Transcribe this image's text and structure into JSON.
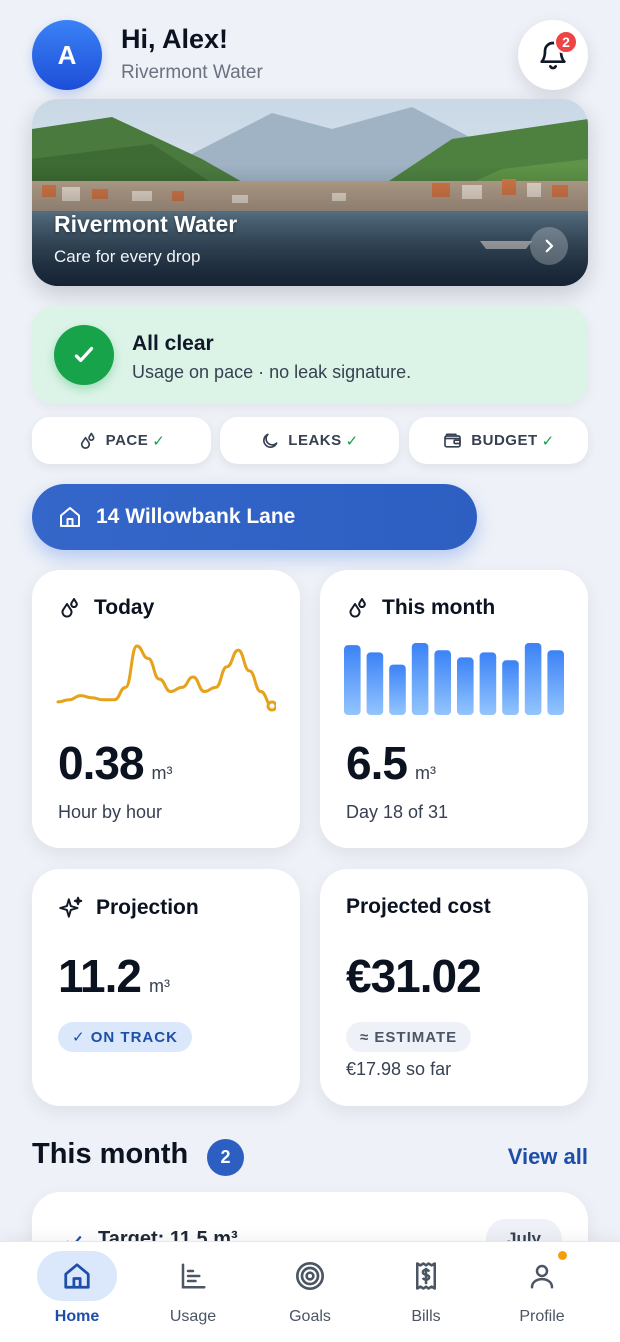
{
  "header": {
    "avatar_initial": "A",
    "greeting": "Hi, Alex!",
    "utility_name": "Rivermont Water",
    "notification_count": "2"
  },
  "hero": {
    "title": "Rivermont Water",
    "subtitle": "Care for every drop"
  },
  "status": {
    "title": "All clear",
    "subtitle": "Usage on pace · no leak signature."
  },
  "chips": [
    {
      "label": "PACE",
      "check": "✓",
      "icon": "drops-icon"
    },
    {
      "label": "LEAKS",
      "check": "✓",
      "icon": "moon-icon"
    },
    {
      "label": "BUDGET",
      "check": "✓",
      "icon": "wallet-icon"
    }
  ],
  "address": {
    "label": "14 Willowbank Lane",
    "icon": "home-icon"
  },
  "today": {
    "title": "Today",
    "value": "0.38",
    "unit": "m³",
    "caption": "Hour by hour",
    "sparkline": [
      0.35,
      0.36,
      0.38,
      0.37,
      0.36,
      0.36,
      0.42,
      0.62,
      0.56,
      0.46,
      0.4,
      0.42,
      0.47,
      0.4,
      0.42,
      0.52,
      0.6,
      0.5,
      0.4,
      0.33
    ],
    "line_color": "#e5a21a"
  },
  "month": {
    "title": "This month",
    "value": "6.5",
    "unit": "m³",
    "caption": "Day 18 of 31",
    "bars": [
      0.97,
      0.87,
      0.7,
      1.0,
      0.9,
      0.8,
      0.87,
      0.76,
      1.0,
      0.9
    ],
    "bar_color": "#3b82f6"
  },
  "projection": {
    "title": "Projection",
    "value": "11.2",
    "unit": "m³",
    "pill": "✓ ON TRACK"
  },
  "cost": {
    "title": "Projected cost",
    "value": "€31.02",
    "pill": "≈ ESTIMATE",
    "caption": "€17.98 so far"
  },
  "section": {
    "title": "This month",
    "count": "2",
    "view_all": "View all"
  },
  "peek_card": {
    "title": "Target: 11.5 m³",
    "pill": "July"
  },
  "nav": [
    {
      "label": "Home",
      "icon": "home-icon",
      "active": true
    },
    {
      "label": "Usage",
      "icon": "bar-chart-icon",
      "active": false
    },
    {
      "label": "Goals",
      "icon": "target-icon",
      "active": false
    },
    {
      "label": "Bills",
      "icon": "receipt-dollar-icon",
      "active": false
    },
    {
      "label": "Profile",
      "icon": "user-icon",
      "active": false
    }
  ]
}
